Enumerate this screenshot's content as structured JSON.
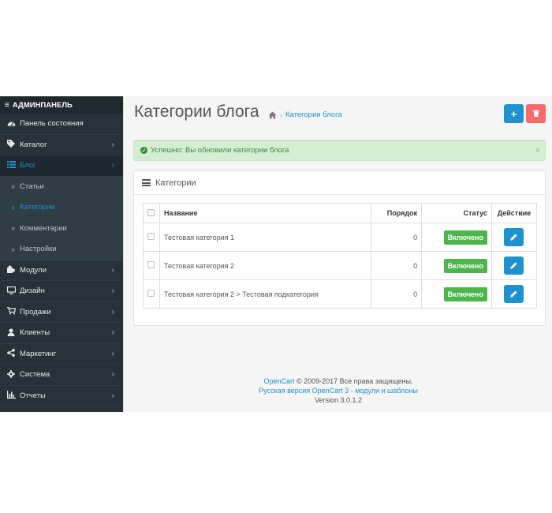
{
  "sidebar": {
    "header": "АДМИНПАНЕЛЬ",
    "items": [
      {
        "label": "Панель состояния",
        "icon": "dashboard-icon"
      },
      {
        "label": "Каталог",
        "icon": "tag-icon"
      },
      {
        "label": "Блог",
        "icon": "list-icon",
        "active": true
      },
      {
        "label": "Модули",
        "icon": "puzzle-icon"
      },
      {
        "label": "Дизайн",
        "icon": "monitor-icon"
      },
      {
        "label": "Продажи",
        "icon": "cart-icon"
      },
      {
        "label": "Клиенты",
        "icon": "user-icon"
      },
      {
        "label": "Маркетинг",
        "icon": "share-icon"
      },
      {
        "label": "Система",
        "icon": "gear-icon"
      },
      {
        "label": "Отчеты",
        "icon": "bar-chart-icon"
      }
    ],
    "blog_sub": [
      "Статьи",
      "Категории",
      "Комментарии",
      "Настройки"
    ],
    "blog_sub_active": "Категории"
  },
  "page": {
    "title": "Категории блога",
    "breadcrumb": "Категории блога"
  },
  "alert": {
    "text": "Успешно: Вы обновили категории блога",
    "close": "×"
  },
  "panel": {
    "title": "Категории",
    "columns": {
      "name": "Название",
      "order": "Порядок",
      "status": "Статус",
      "action": "Действие"
    },
    "rows": [
      {
        "name": "Тестовая категория 1",
        "order": "0",
        "status": "Включено"
      },
      {
        "name": "Тестовая категория 2",
        "order": "0",
        "status": "Включено"
      },
      {
        "name": "Тестовая категория 2 > Тестовая подкатегория",
        "order": "0",
        "status": "Включено"
      }
    ]
  },
  "footer": {
    "link1": "OpenCart",
    "text1": " © 2009-2017 Все права защищены.",
    "link2": "Русская версия OpenCart 3 - модули и шаблоны",
    "version": "Version 3.0.1.2"
  },
  "colors": {
    "accent": "#1e91cf",
    "danger": "#f56b6b",
    "success": "#4cb64c",
    "sidebar": "#263238"
  }
}
